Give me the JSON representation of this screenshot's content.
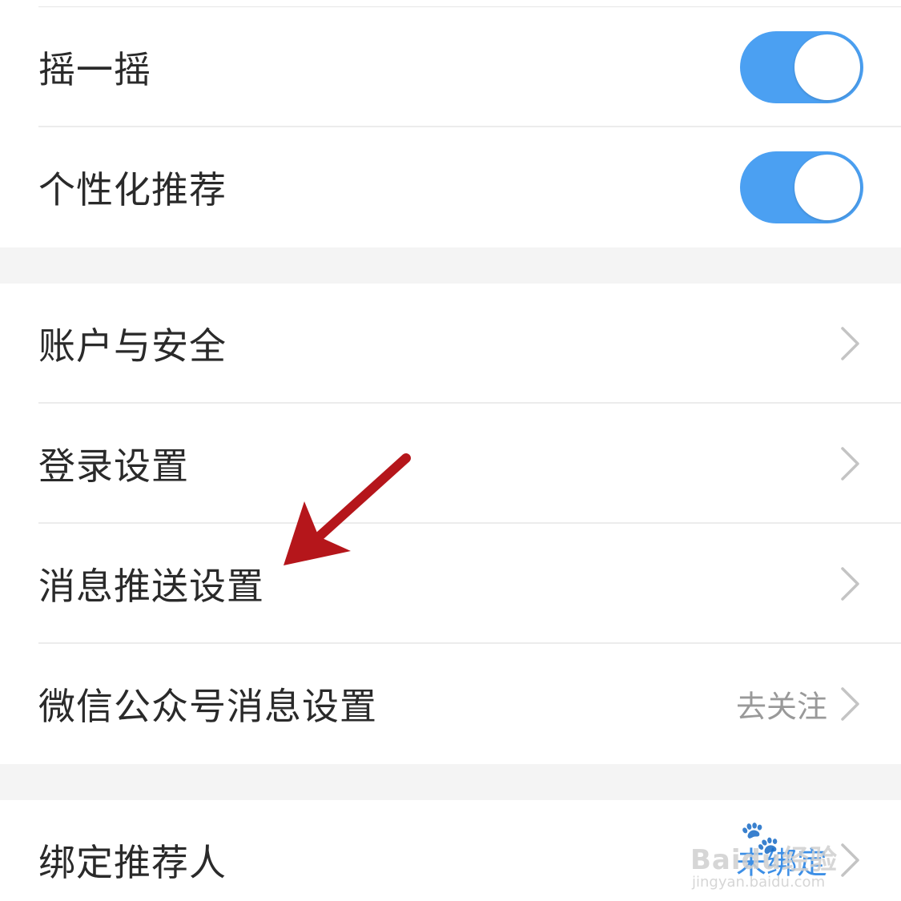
{
  "section1": {
    "items": [
      {
        "label": "摇一摇",
        "toggle_on": true
      },
      {
        "label": "个性化推荐",
        "toggle_on": true
      }
    ]
  },
  "section2": {
    "items": [
      {
        "label": "账户与安全",
        "value": ""
      },
      {
        "label": "登录设置",
        "value": ""
      },
      {
        "label": "消息推送设置",
        "value": ""
      },
      {
        "label": "微信公众号消息设置",
        "value": "去关注"
      }
    ]
  },
  "section3": {
    "items": [
      {
        "label": "绑定推荐人",
        "value": "未绑定"
      }
    ]
  },
  "colors": {
    "toggle_on": "#4ba0f2",
    "annotation_arrow": "#b5161b",
    "value_gray": "#999999",
    "value_blue": "#3d8fe6"
  },
  "watermark": {
    "brand": "Baidu经验",
    "url": "jingyan.baidu.com"
  }
}
